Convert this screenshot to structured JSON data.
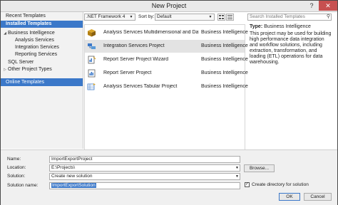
{
  "window": {
    "title": "New Project",
    "help": "?",
    "close": "✕"
  },
  "left": {
    "recent": "Recent Templates",
    "installed": "Installed Templates",
    "tree": [
      {
        "label": "Business Intelligence",
        "level": 0,
        "arrow": "◢"
      },
      {
        "label": "Analysis Services",
        "level": 1
      },
      {
        "label": "Integration Services",
        "level": 1
      },
      {
        "label": "Reporting Services",
        "level": 1
      },
      {
        "label": "SQL Server",
        "level": 0
      },
      {
        "label": "Other Project Types",
        "level": 0,
        "arrow": "▷"
      }
    ],
    "online": "Online Templates"
  },
  "toolbar": {
    "framework": ".NET Framework 4",
    "sort_label": "Sort by:",
    "sort_value": "Default",
    "search_placeholder": "Search Installed Templates"
  },
  "templates": [
    {
      "name": "Analysis Services Multidimensional and Data Mi...",
      "category": "Business Intelligence",
      "icon": "cube-icon"
    },
    {
      "name": "Integration Services Project",
      "category": "Business Intelligence",
      "icon": "integration-icon",
      "selected": true
    },
    {
      "name": "Report Server Project Wizard",
      "category": "Business Intelligence",
      "icon": "report-wizard-icon"
    },
    {
      "name": "Report Server Project",
      "category": "Business Intelligence",
      "icon": "report-icon"
    },
    {
      "name": "Analysis Services Tabular Project",
      "category": "Business Intelligence",
      "icon": "tabular-icon"
    }
  ],
  "details": {
    "type_label": "Type:",
    "type_value": "Business Intelligence",
    "description": "This project may be used for building high performance data integration and workflow solutions, including extraction, transformation, and loading (ETL) operations for data warehousing."
  },
  "form": {
    "name_label": "Name:",
    "name_value": "ImportExportProject",
    "location_label": "Location:",
    "location_value": "E:\\Projects\\",
    "solution_label": "Solution:",
    "solution_value": "Create new solution",
    "solution_name_label": "Solution name:",
    "solution_name_value": "ImportExportSolution",
    "browse": "Browse...",
    "create_dir": "Create directory for solution",
    "create_dir_checked": "✓",
    "ok": "OK",
    "cancel": "Cancel"
  },
  "colors": {
    "accent": "#3b78c9",
    "close": "#c75050"
  }
}
